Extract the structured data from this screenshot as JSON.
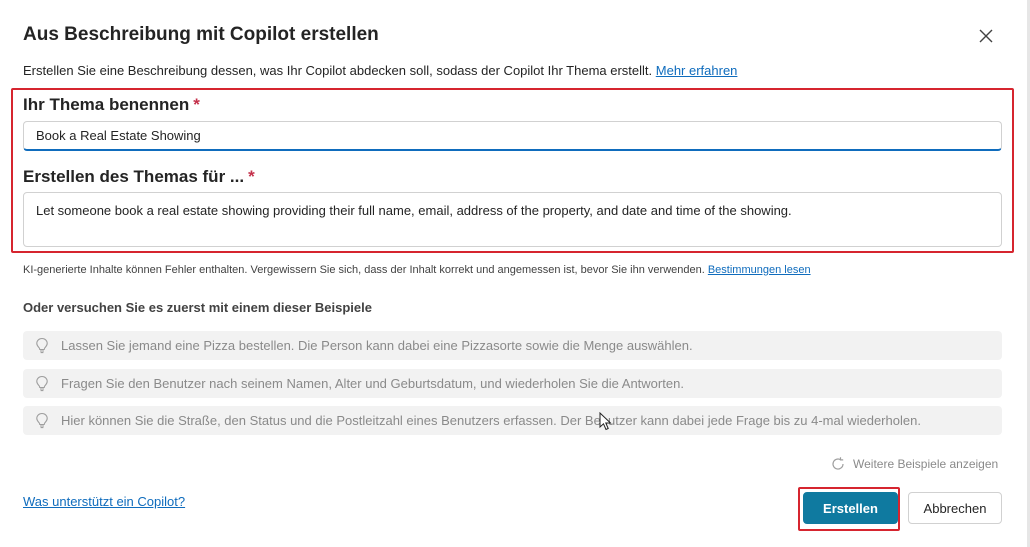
{
  "dialog": {
    "title": "Aus Beschreibung mit Copilot erstellen",
    "description": "Erstellen Sie eine Beschreibung dessen, was Ihr Copilot abdecken soll, sodass der Copilot Ihr Thema erstellt. ",
    "learn_more": "Mehr erfahren",
    "close_icon": "close-icon"
  },
  "form": {
    "name_label": "Ihr Thema benennen",
    "name_value": "Book a Real Estate Showing",
    "create_label": "Erstellen des Themas für ...",
    "create_value": "Let someone book a real estate showing providing their full name, email, address of the property, and date and time of the showing.",
    "required_marker": "*"
  },
  "disclaimer": {
    "text": "KI-generierte Inhalte können Fehler enthalten. Vergewissern Sie sich, dass der Inhalt korrekt und angemessen ist, bevor Sie ihn verwenden. ",
    "terms_link": "Bestimmungen lesen"
  },
  "examples": {
    "title": "Oder versuchen Sie es zuerst mit einem dieser Beispiele",
    "icon": "lightbulb-icon",
    "items": [
      "Lassen Sie jemand eine Pizza bestellen. Die Person kann dabei eine Pizzasorte sowie die Menge auswählen.",
      "Fragen Sie den Benutzer nach seinem Namen, Alter und Geburtsdatum, und wiederholen Sie die Antworten.",
      "Hier können Sie die Straße, den Status und die Postleitzahl eines Benutzers erfassen. Der Benutzer kann dabei jede Frage bis zu 4-mal wiederholen."
    ],
    "more_label": "Weitere Beispiele anzeigen"
  },
  "footer": {
    "help_link": "Was unterstützt ein Copilot?",
    "create_button": "Erstellen",
    "cancel_button": "Abbrechen"
  },
  "colors": {
    "primary": "#0f7aa0",
    "link": "#0f6cbd",
    "highlight": "#d6252f",
    "required": "#c4314b"
  }
}
